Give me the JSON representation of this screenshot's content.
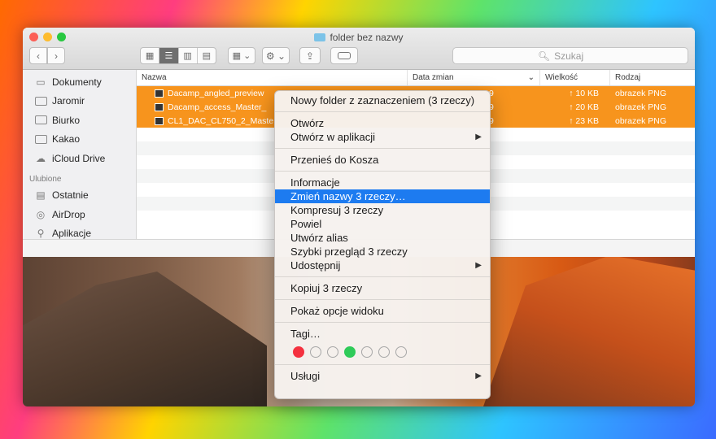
{
  "window": {
    "title": "folder bez nazwy",
    "search_placeholder": "Szukaj"
  },
  "toolbar": {
    "back_icon": "‹",
    "forward_icon": "›"
  },
  "sidebar": {
    "items": [
      {
        "label": "Dokumenty",
        "icon": "document-icon"
      },
      {
        "label": "Jaromir",
        "icon": "folder-icon"
      },
      {
        "label": "Biurko",
        "icon": "folder-icon"
      },
      {
        "label": "Kakao",
        "icon": "folder-icon"
      },
      {
        "label": "iCloud Drive",
        "icon": "cloud-icon"
      }
    ],
    "favorites_heading": "Ulubione",
    "favorites": [
      {
        "label": "Ostatnie",
        "icon": "recents-icon"
      },
      {
        "label": "AirDrop",
        "icon": "airdrop-icon"
      },
      {
        "label": "Aplikacje",
        "icon": "applications-icon"
      }
    ]
  },
  "columns": {
    "name": "Nazwa",
    "date": "Data zmian",
    "size": "Wielkość",
    "kind": "Rodzaj"
  },
  "files": [
    {
      "name": "Dacamp_angled_preview",
      "date": "9",
      "size": "↑ 10 KB",
      "kind": "obrazek PNG"
    },
    {
      "name": "Dacamp_access_Master_",
      "date": "9",
      "size": "↑ 20 KB",
      "kind": "obrazek PNG"
    },
    {
      "name": "CL1_DAC_CL750_2_Maste",
      "date": "9",
      "size": "↑ 23 KB",
      "kind": "obrazek PNG"
    }
  ],
  "statusbar": {
    "text": "zo"
  },
  "context_menu": {
    "new_folder": "Nowy folder z zaznaczeniem (3 rzeczy)",
    "open": "Otwórz",
    "open_with": "Otwórz w aplikacji",
    "trash": "Przenieś do Kosza",
    "info": "Informacje",
    "rename": "Zmień nazwy 3 rzeczy…",
    "compress": "Kompresuj 3 rzeczy",
    "duplicate": "Powiel",
    "alias": "Utwórz alias",
    "quicklook": "Szybki przegląd 3 rzeczy",
    "share": "Udostępnij",
    "copy": "Kopiuj 3 rzeczy",
    "view_options": "Pokaż opcje widoku",
    "tags": "Tagi…",
    "services": "Usługi",
    "submenu_arrow": "▶",
    "tag_colors": [
      "#f4313f",
      "none",
      "none",
      "#2fcb59",
      "none",
      "none",
      "none"
    ]
  },
  "colors": {
    "selection": "#f7941d",
    "menu_highlight": "#1d7bf0"
  }
}
